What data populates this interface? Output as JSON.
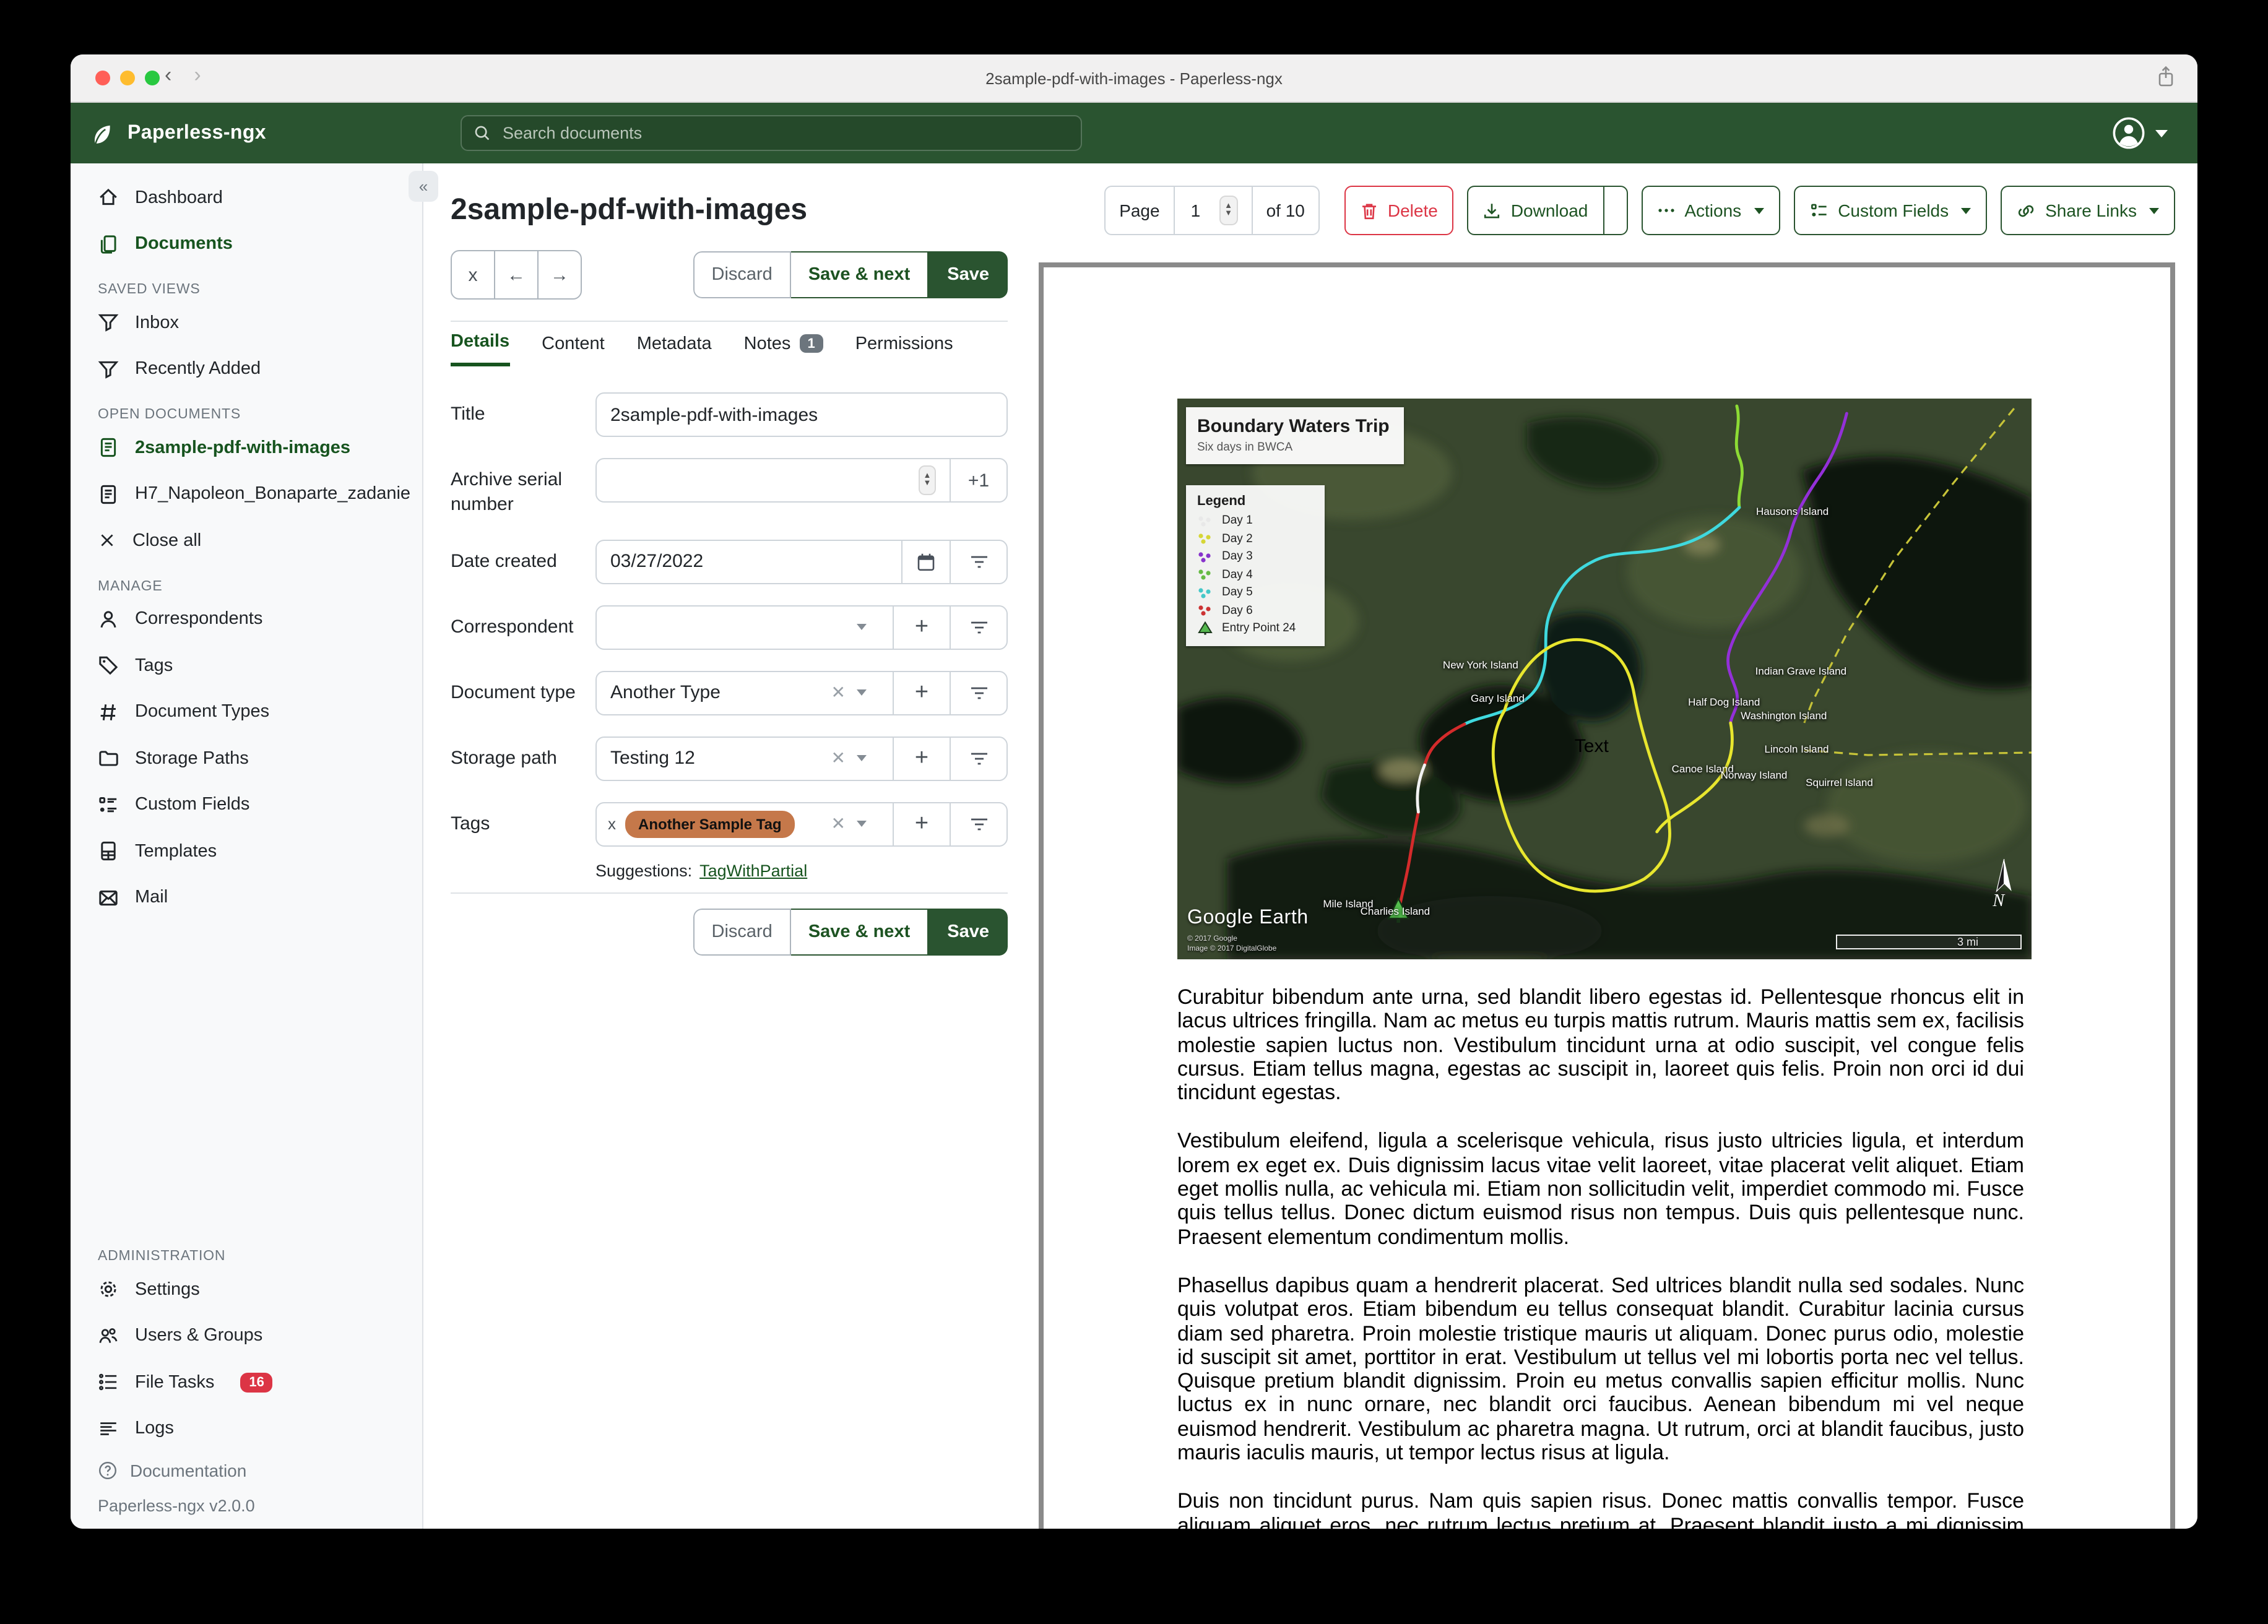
{
  "colors": {
    "header_green": "#2a5430",
    "accent_green": "#17541f",
    "delete_red": "#dc3545",
    "badge_red": "#dc3545",
    "tag_orange": "#c5784a"
  },
  "window": {
    "title": "2sample-pdf-with-images - Paperless-ngx"
  },
  "header": {
    "brand": "Paperless-ngx",
    "search_placeholder": "Search documents"
  },
  "sidebar": {
    "nav": [
      {
        "label": "Dashboard"
      },
      {
        "label": "Documents"
      }
    ],
    "saved_views": {
      "title": "SAVED VIEWS",
      "items": [
        {
          "label": "Inbox"
        },
        {
          "label": "Recently Added"
        }
      ]
    },
    "open_documents": {
      "title": "OPEN DOCUMENTS",
      "items": [
        {
          "label": "2sample-pdf-with-images"
        },
        {
          "label": "H7_Napoleon_Bonaparte_zadanie"
        }
      ],
      "close_all": "Close all"
    },
    "manage": {
      "title": "MANAGE",
      "items": [
        {
          "label": "Correspondents"
        },
        {
          "label": "Tags"
        },
        {
          "label": "Document Types"
        },
        {
          "label": "Storage Paths"
        },
        {
          "label": "Custom Fields"
        },
        {
          "label": "Templates"
        },
        {
          "label": "Mail"
        }
      ]
    },
    "administration": {
      "title": "ADMINISTRATION",
      "items": [
        {
          "label": "Settings"
        },
        {
          "label": "Users & Groups"
        },
        {
          "label": "File Tasks",
          "badge": "16"
        },
        {
          "label": "Logs"
        }
      ]
    },
    "documentation": "Documentation",
    "version": "Paperless-ngx v2.0.0"
  },
  "doc": {
    "title": "2sample-pdf-with-images",
    "pager": {
      "page_label": "Page",
      "value": "1",
      "of_label": "of 10"
    },
    "actions": {
      "delete": "Delete",
      "download": "Download",
      "actions": "Actions",
      "custom_fields": "Custom Fields",
      "share_links": "Share Links"
    },
    "editbar": {
      "close": "x",
      "discard": "Discard",
      "save_next": "Save & next",
      "save": "Save"
    },
    "tabs": [
      {
        "label": "Details"
      },
      {
        "label": "Content"
      },
      {
        "label": "Metadata"
      },
      {
        "label": "Notes",
        "badge": "1"
      },
      {
        "label": "Permissions"
      }
    ],
    "form": {
      "title_label": "Title",
      "title_value": "2sample-pdf-with-images",
      "asn_label": "Archive serial number",
      "asn_value": "",
      "plus_one": "+1",
      "date_label": "Date created",
      "date_value": "03/27/2022",
      "correspondent_label": "Correspondent",
      "doc_type_label": "Document type",
      "doc_type_value": "Another Type",
      "storage_label": "Storage path",
      "storage_value": "Testing 12",
      "tags_label": "Tags",
      "tag_value": "Another Sample Tag",
      "suggestions_label": "Suggestions:",
      "suggestion_link": "TagWithPartial"
    }
  },
  "preview": {
    "map": {
      "title": "Boundary Waters Trip",
      "subtitle": "Six days in BWCA",
      "legend_title": "Legend",
      "legend": [
        {
          "label": "Day 1",
          "color": "#e8e8e8"
        },
        {
          "label": "Day 2",
          "color": "#d6d636"
        },
        {
          "label": "Day 3",
          "color": "#8833cc"
        },
        {
          "label": "Day 4",
          "color": "#66bb44"
        },
        {
          "label": "Day 5",
          "color": "#44c8c8"
        },
        {
          "label": "Day 6",
          "color": "#cc3333"
        },
        {
          "label": "Entry Point 24",
          "color": "#55b84e"
        }
      ],
      "labels": [
        "Hausons Island",
        "New York Island",
        "Gary Island",
        "Indian Grave Island",
        "Half Dog Island",
        "Washington Island",
        "Lincoln Island",
        "Canoe Island",
        "Norway Island",
        "Squirrel Island",
        "Mile Island",
        "Charlies Island"
      ],
      "text_annotation": "Text",
      "attribution": {
        "logo": "Google Earth",
        "line1": "© 2017 Google",
        "line2": "Image © 2017 DigitalGlobe"
      },
      "scale": "3 mi",
      "compass": "N"
    },
    "paragraphs": [
      "Curabitur bibendum ante urna, sed blandit libero egestas id. Pellentesque rhoncus elit in lacus ultrices fringilla. Nam ac metus eu turpis mattis rutrum. Mauris mattis sem ex, facilisis molestie sapien luctus non. Vestibulum tincidunt urna at odio suscipit, vel congue felis cursus. Etiam tellus magna, egestas ac suscipit in, laoreet quis felis. Proin non orci id dui tincidunt egestas.",
      "Vestibulum eleifend, ligula a scelerisque vehicula, risus justo ultricies ligula, et interdum lorem ex eget ex. Duis dignissim lacus vitae velit laoreet, vitae placerat velit aliquet. Etiam eget mollis nulla, ac vehicula mi. Etiam non sollicitudin velit, imperdiet commodo mi. Fusce quis tellus tellus. Donec dictum euismod risus non tempus. Duis quis pellentesque nunc. Praesent elementum condimentum mollis.",
      "Phasellus dapibus quam a hendrerit placerat. Sed ultrices blandit nulla sed sodales. Nunc quis volutpat eros. Etiam bibendum eu tellus consequat blandit. Curabitur lacinia cursus diam sed pharetra. Proin molestie tristique mauris ut aliquam. Donec purus odio, molestie id suscipit sit amet, porttitor in erat. Vestibulum ut tellus vel mi lobortis porta nec vel tellus. Quisque pretium blandit dignissim. Proin eu metus convallis sapien efficitur mollis. Nunc luctus ex in nunc ornare, nec blandit orci faucibus. Aenean bibendum mi vel neque euismod hendrerit. Vestibulum ac pharetra magna. Ut rutrum, orci at blandit faucibus, justo mauris iaculis mauris, ut tempor lectus risus at ligula.",
      "Duis non tincidunt purus. Nam quis sapien risus. Donec mattis convallis tempor. Fusce aliquam aliquet eros, nec rutrum lectus pretium at. Praesent blandit justo a mi dignissim placerat. Ut ullamcorper elit eget diam maximus iaculis. In bibendum in massa eget facilisis. In iaculis lectus"
    ]
  }
}
